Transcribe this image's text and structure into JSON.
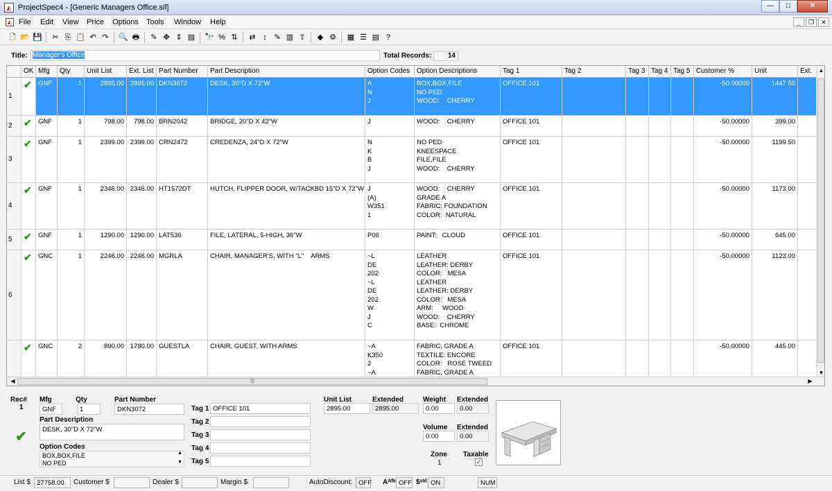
{
  "window": {
    "title": "ProjectSpec4 - [Generic Managers Office.sif]",
    "minimize": "—",
    "maximize": "□",
    "close": "✕"
  },
  "menu": [
    "File",
    "Edit",
    "View",
    "Price",
    "Options",
    "Tools",
    "Window",
    "Help"
  ],
  "mdi": {
    "minimize": "_",
    "restore": "❐",
    "close": "✕"
  },
  "toolbar": {
    "groups": [
      [
        "new-file-icon",
        "open-folder-icon",
        "save-icon"
      ],
      [
        "cut-icon",
        "copy-icon",
        "paste-icon",
        "undo-icon",
        "redo-icon"
      ],
      [
        "print-preview-icon",
        "print-icon"
      ],
      [
        "eraser-icon",
        "move-icon",
        "sort-icon",
        "catalog-icon"
      ],
      [
        "find-icon",
        "percent-icon",
        "renumber-icon"
      ],
      [
        "transfer-icon",
        "sort-az-icon",
        "edit-icon",
        "report-icon",
        "export-icon"
      ],
      [
        "validate-icon",
        "settings-icon"
      ],
      [
        "image-icon",
        "notes-icon",
        "database-icon",
        "help-icon"
      ]
    ],
    "glyphs": [
      "🗋",
      "📂",
      "💾",
      "✂",
      "⎘",
      "📋",
      "↶",
      "↷",
      "🔍",
      "🖶",
      "✎",
      "✥",
      "⇕",
      "▤",
      "🔭",
      "%",
      "⇅",
      "⇄",
      "↕",
      "✎",
      "▥",
      "⇪",
      "◆",
      "⚙",
      "▦",
      "☰",
      "▤",
      "?"
    ]
  },
  "header": {
    "title_label": "Title:",
    "title_value": "Manager's Office",
    "total_label": "Total Records:",
    "total_value": "14"
  },
  "columns": [
    "",
    "OK",
    "Mfg",
    "Qty",
    "Unit List",
    "Ext. List",
    "Part Number",
    "Part Description",
    "Option Codes",
    "Option Descriptions",
    "Tag 1",
    "Tag 2",
    "Tag 3",
    "Tag 4",
    "Tag 5",
    "Customer %",
    "Unit",
    "Ext."
  ],
  "rows": [
    {
      "n": "1",
      "ok": "✔",
      "mfg": "GNF",
      "qty": "1",
      "unit_list": "2895.00",
      "ext_list": "2895.00",
      "part": "DKN3072",
      "desc": "DESK, 30\"D X 72\"W",
      "codes": "A\nN\nJ",
      "opts": "BOX,BOX,FILE\nNO PED\nWOOD:    CHERRY",
      "tag1": "OFFICE 101",
      "cust": "-50.00000",
      "unit": "1447.50"
    },
    {
      "n": "2",
      "ok": "✔",
      "mfg": "GNF",
      "qty": "1",
      "unit_list": "798.00",
      "ext_list": "798.00",
      "part": "BRN2042",
      "desc": "BRIDGE, 20\"D X 42\"W",
      "codes": "J",
      "opts": "WOOD:    CHERRY",
      "tag1": "OFFICE 101",
      "cust": "-50.00000",
      "unit": "399.00"
    },
    {
      "n": "3",
      "ok": "✔",
      "mfg": "GNF",
      "qty": "1",
      "unit_list": "2399.00",
      "ext_list": "2399.00",
      "part": "CRN2472",
      "desc": "CREDENZA, 24\"D X 72\"W",
      "codes": "N\nK\nB\nJ",
      "opts": "NO PED\nKNEESPACE\nFILE,FILE\nWOOD:    CHERRY",
      "tag1": "OFFICE 101",
      "cust": "-50.00000",
      "unit": "1199.50"
    },
    {
      "n": "4",
      "ok": "✔",
      "mfg": "GNF",
      "qty": "1",
      "unit_list": "2346.00",
      "ext_list": "2346.00",
      "part": "HT1572DT",
      "desc": "HUTCH, FLIPPER DOOR, W/TACKBD 15\"D X 72\"W",
      "codes": "J\n(A)\nW351\n1",
      "opts": "WOOD:    CHERRY\nGRADE A\nFABRIC: FOUNDATION\nCOLOR:  NATURAL",
      "tag1": "OFFICE 101",
      "cust": "-50.00000",
      "unit": "1173.00"
    },
    {
      "n": "5",
      "ok": "✔",
      "mfg": "GNF",
      "qty": "1",
      "unit_list": "1290.00",
      "ext_list": "1290.00",
      "part": "LAT536",
      "desc": "FILE, LATERAL, 5-HIGH, 36\"W",
      "codes": "P06",
      "opts": "PAINT:   CLOUD",
      "tag1": "OFFICE 101",
      "cust": "-50.00000",
      "unit": "645.00"
    },
    {
      "n": "6",
      "ok": "✔",
      "mfg": "GNC",
      "qty": "1",
      "unit_list": "2246.00",
      "ext_list": "2246.00",
      "part": "MGRLA",
      "desc": "CHAIR, MANAGER'S, WITH \"L\"    ARMS",
      "codes": "~L\nDE\n202\n~L\nDE\n202\nW\nJ\nC",
      "opts": "LEATHER\nLEATHER: DERBY\nCOLOR:   MESA\nLEATHER\nLEATHER: DERBY\nCOLOR:   MESA\nARM:     WOOD\nWOOD:    CHERRY\nBASE:  CHROME",
      "tag1": "OFFICE 101",
      "cust": "-50.00000",
      "unit": "1123.00"
    },
    {
      "n": "",
      "ok": "✔",
      "mfg": "GNC",
      "qty": "2",
      "unit_list": "890.00",
      "ext_list": "1780.00",
      "part": "GUESTLA",
      "desc": "CHAIR, GUEST, WITH ARMS",
      "codes": "~A\nK350\n2\n~A",
      "opts": "FABRIC, GRADE A\nTEXTILE: ENCORE\nCOLOR:   ROSE TWEED\nFABRIC, GRADE A",
      "tag1": "OFFICE 101",
      "cust": "-50.00000",
      "unit": "445.00"
    }
  ],
  "detail": {
    "rec_label": "Rec#",
    "rec_value": "1",
    "mfg_label": "Mfg",
    "mfg_value": "GNF",
    "qty_label": "Qty",
    "qty_value": "1",
    "part_label": "Part Number",
    "part_value": "DKN3072",
    "desc_label": "Part Description",
    "desc_value": "DESK, 30\"D X 72\"W",
    "codes_label": "Option Codes",
    "codes_value": "BOX,BOX,FILE\nNO PED",
    "ok_mark": "✔",
    "tag1_label": "Tag 1",
    "tag1_value": "OFFICE 101",
    "tag2_label": "Tag 2",
    "tag2_value": "",
    "tag3_label": "Tag 3",
    "tag3_value": "",
    "tag4_label": "Tag 4",
    "tag4_value": "",
    "tag5_label": "Tag 5",
    "tag5_value": "",
    "unitlist_label": "Unit List",
    "unitlist_value": "2895.00",
    "extended_label": "Extended",
    "extended_value": "2895.00",
    "weight_label": "Weight",
    "weight_value": "0.00",
    "wext_label": "Extended",
    "wext_value": "0.00",
    "volume_label": "Volume",
    "volume_value": "0.00",
    "vext_label": "Extended",
    "vext_value": "0.00",
    "zone_label": "Zone",
    "zone_value": "1",
    "taxable_label": "Taxable",
    "taxable_mark": "✓"
  },
  "status": {
    "list_label": "List $",
    "list_value": "27758.00",
    "customer_label": "Customer $",
    "customer_value": "",
    "dealer_label": "Dealer $",
    "dealer_value": "",
    "margin_label": "Margin $",
    "margin_value": "",
    "autodiscount_label": "AutoDiscount:",
    "autodiscount_value": "OFF",
    "alfa_label": "Aᴬᶠᵇ",
    "alfa_value": "OFF",
    "std_label": "$ˢᵗᵈ",
    "std_value": "ON",
    "num_value": "NUM"
  },
  "colors": {
    "selection": "#3399ff",
    "check": "#2a9a1a"
  }
}
